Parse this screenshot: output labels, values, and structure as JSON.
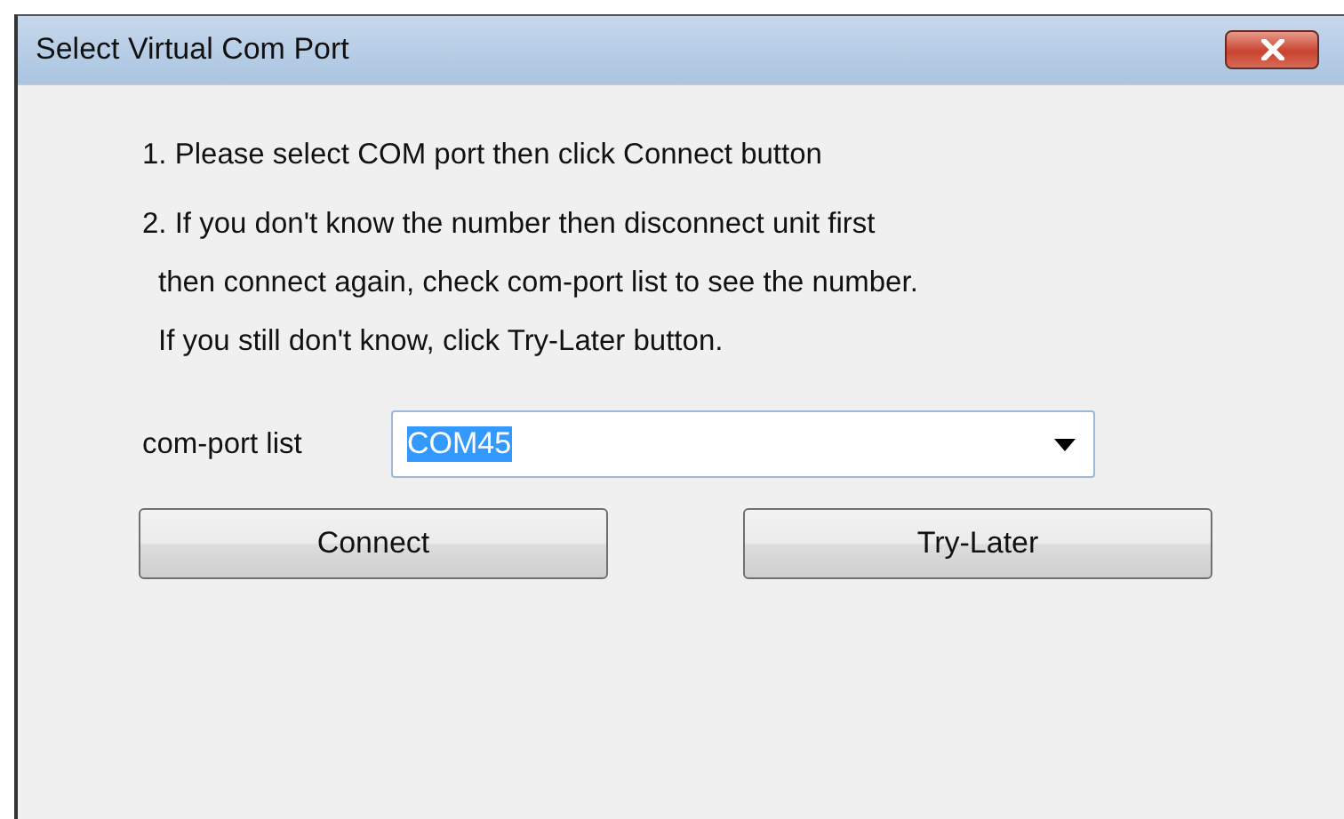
{
  "window": {
    "title": "Select Virtual Com Port"
  },
  "instructions": [
    "1. Please select COM port then click Connect button",
    "2. If you don't know the number then disconnect unit first",
    "then connect again, check com-port list to see the number.",
    "If you still don't know, click Try-Later button."
  ],
  "com_port": {
    "label": "com-port list",
    "value": "COM45",
    "value_selected": true
  },
  "buttons": [
    "Connect",
    "Try-Later"
  ]
}
